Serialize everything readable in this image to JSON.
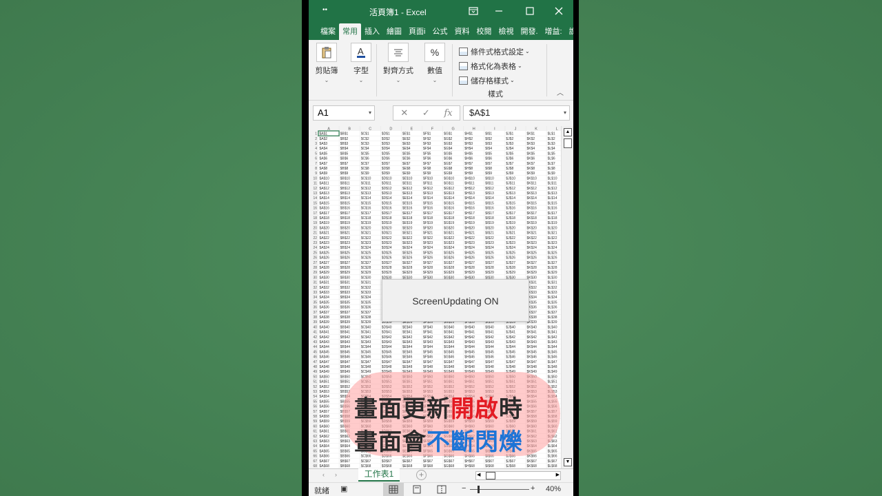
{
  "window": {
    "title": "活頁簿1  -  Excel",
    "qat": "••"
  },
  "tabs": [
    "檔案",
    "常用",
    "插入",
    "繪圖",
    "頁面i",
    "公式",
    "資料",
    "校閱",
    "檢視",
    "開發.",
    "增益:",
    "說明"
  ],
  "active_tab": "常用",
  "ribbon": {
    "clipboard": "剪貼簿",
    "font": "字型",
    "alignment": "對齊方式",
    "number": "數值",
    "conditional_format": "條件式格式設定",
    "format_as_table": "格式化為表格",
    "cell_styles": "儲存格樣式",
    "styles_caption": "樣式"
  },
  "formula_bar": {
    "name_box": "A1",
    "formula": "$A$1",
    "fx": "fx"
  },
  "sheet": {
    "columns": [
      "A",
      "B",
      "C",
      "D",
      "E",
      "F",
      "G",
      "H",
      "I",
      "J",
      "K",
      "L"
    ],
    "row_count": 68,
    "cell_pattern": "$COL$ROW"
  },
  "dialog": {
    "message": "ScreenUpdating  ON"
  },
  "caption": {
    "line1_plain": "畫面更新",
    "line1_highlight": "開啟",
    "line1_end": "時",
    "line2_plain": "畫面會",
    "line2_highlight": "不斷閃爍",
    "colors": {
      "dark": "#2b2b2b",
      "red": "#e31b23",
      "blue": "#1e74d6",
      "bg": "#ffa0a0"
    }
  },
  "sheet_tab": "工作表1",
  "status": {
    "ready": "就緒",
    "zoom": "40%"
  },
  "colors": {
    "excel_green": "#217346"
  }
}
